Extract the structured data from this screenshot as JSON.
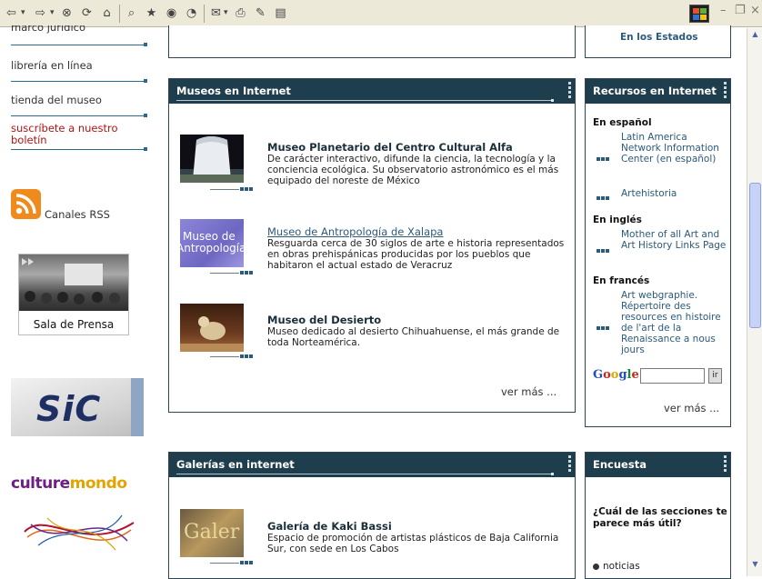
{
  "toolbar": {
    "buttons": [
      "back",
      "forward",
      "stop",
      "refresh",
      "home",
      "search",
      "favorites",
      "history",
      "media",
      "mail",
      "print",
      "edit",
      "discuss"
    ]
  },
  "sidebar": {
    "items": [
      {
        "label": "marco jurídico"
      },
      {
        "label": "librería en línea"
      },
      {
        "label": "tienda del museo"
      },
      {
        "label": "suscríbete a nuestro boletín"
      }
    ],
    "rss_label": "Canales RSS",
    "prensa_label": "Sala de Prensa",
    "sic_logo": "SiC",
    "culture_logo_a": "culture",
    "culture_logo_b": "mondo"
  },
  "top_right_link": "En los Estados",
  "museos": {
    "header": "Museos en Internet",
    "items": [
      {
        "title": "Museo Planetario del Centro Cultural Alfa",
        "description": "De carácter interactivo, difunde la ciencia, la tecnología y la conciencia ecológica. Su observatorio astronómico es el más equipado del noreste de México"
      },
      {
        "title": "Museo de Antropología de Xalapa",
        "description": "Resguarda cerca de 30 siglos de arte e historia representados en obras prehispánicas producidas por los pueblos que habitaron el actual estado de Veracruz",
        "img_text_1": "Museo de",
        "img_text_2": "Antropología"
      },
      {
        "title": "Museo del Desierto",
        "description": "Museo dedicado al desierto Chihuahuense, el más grande de toda Norteamérica."
      }
    ],
    "ver_mas": "ver más ..."
  },
  "galerias": {
    "header": "Galerías en internet",
    "items": [
      {
        "title": "Galería de Kaki Bassi",
        "description": "Espacio de promoción de artistas plásticos de Baja California Sur, con sede en Los Cabos",
        "img_text": "Galer"
      }
    ]
  },
  "recursos": {
    "header": "Recursos en Internet",
    "sections": [
      {
        "name": "En español",
        "links": [
          "Latin America Network Information Center (en español)",
          "Artehistoria"
        ]
      },
      {
        "name": "En inglés",
        "links": [
          "Mother of all Art and Art History Links Page"
        ]
      },
      {
        "name": "En francés",
        "links": [
          "Art webgraphie. Répertoire des resources en histoire de l'art de la Renaissance a nous jours"
        ]
      }
    ],
    "google_logo": [
      "G",
      "o",
      "o",
      "g",
      "l",
      "e"
    ],
    "google_button": "ir",
    "google_value": "",
    "ver_mas": "ver más ..."
  },
  "encuesta": {
    "header": "Encuesta",
    "question": "¿Cuál de las secciones te parece más útil?",
    "option": "noticias"
  },
  "colors": {
    "header_bg": "#1f3e4d",
    "link": "#2b5a7a",
    "accent_red": "#b41212",
    "rss_orange": "#f08a1c"
  }
}
